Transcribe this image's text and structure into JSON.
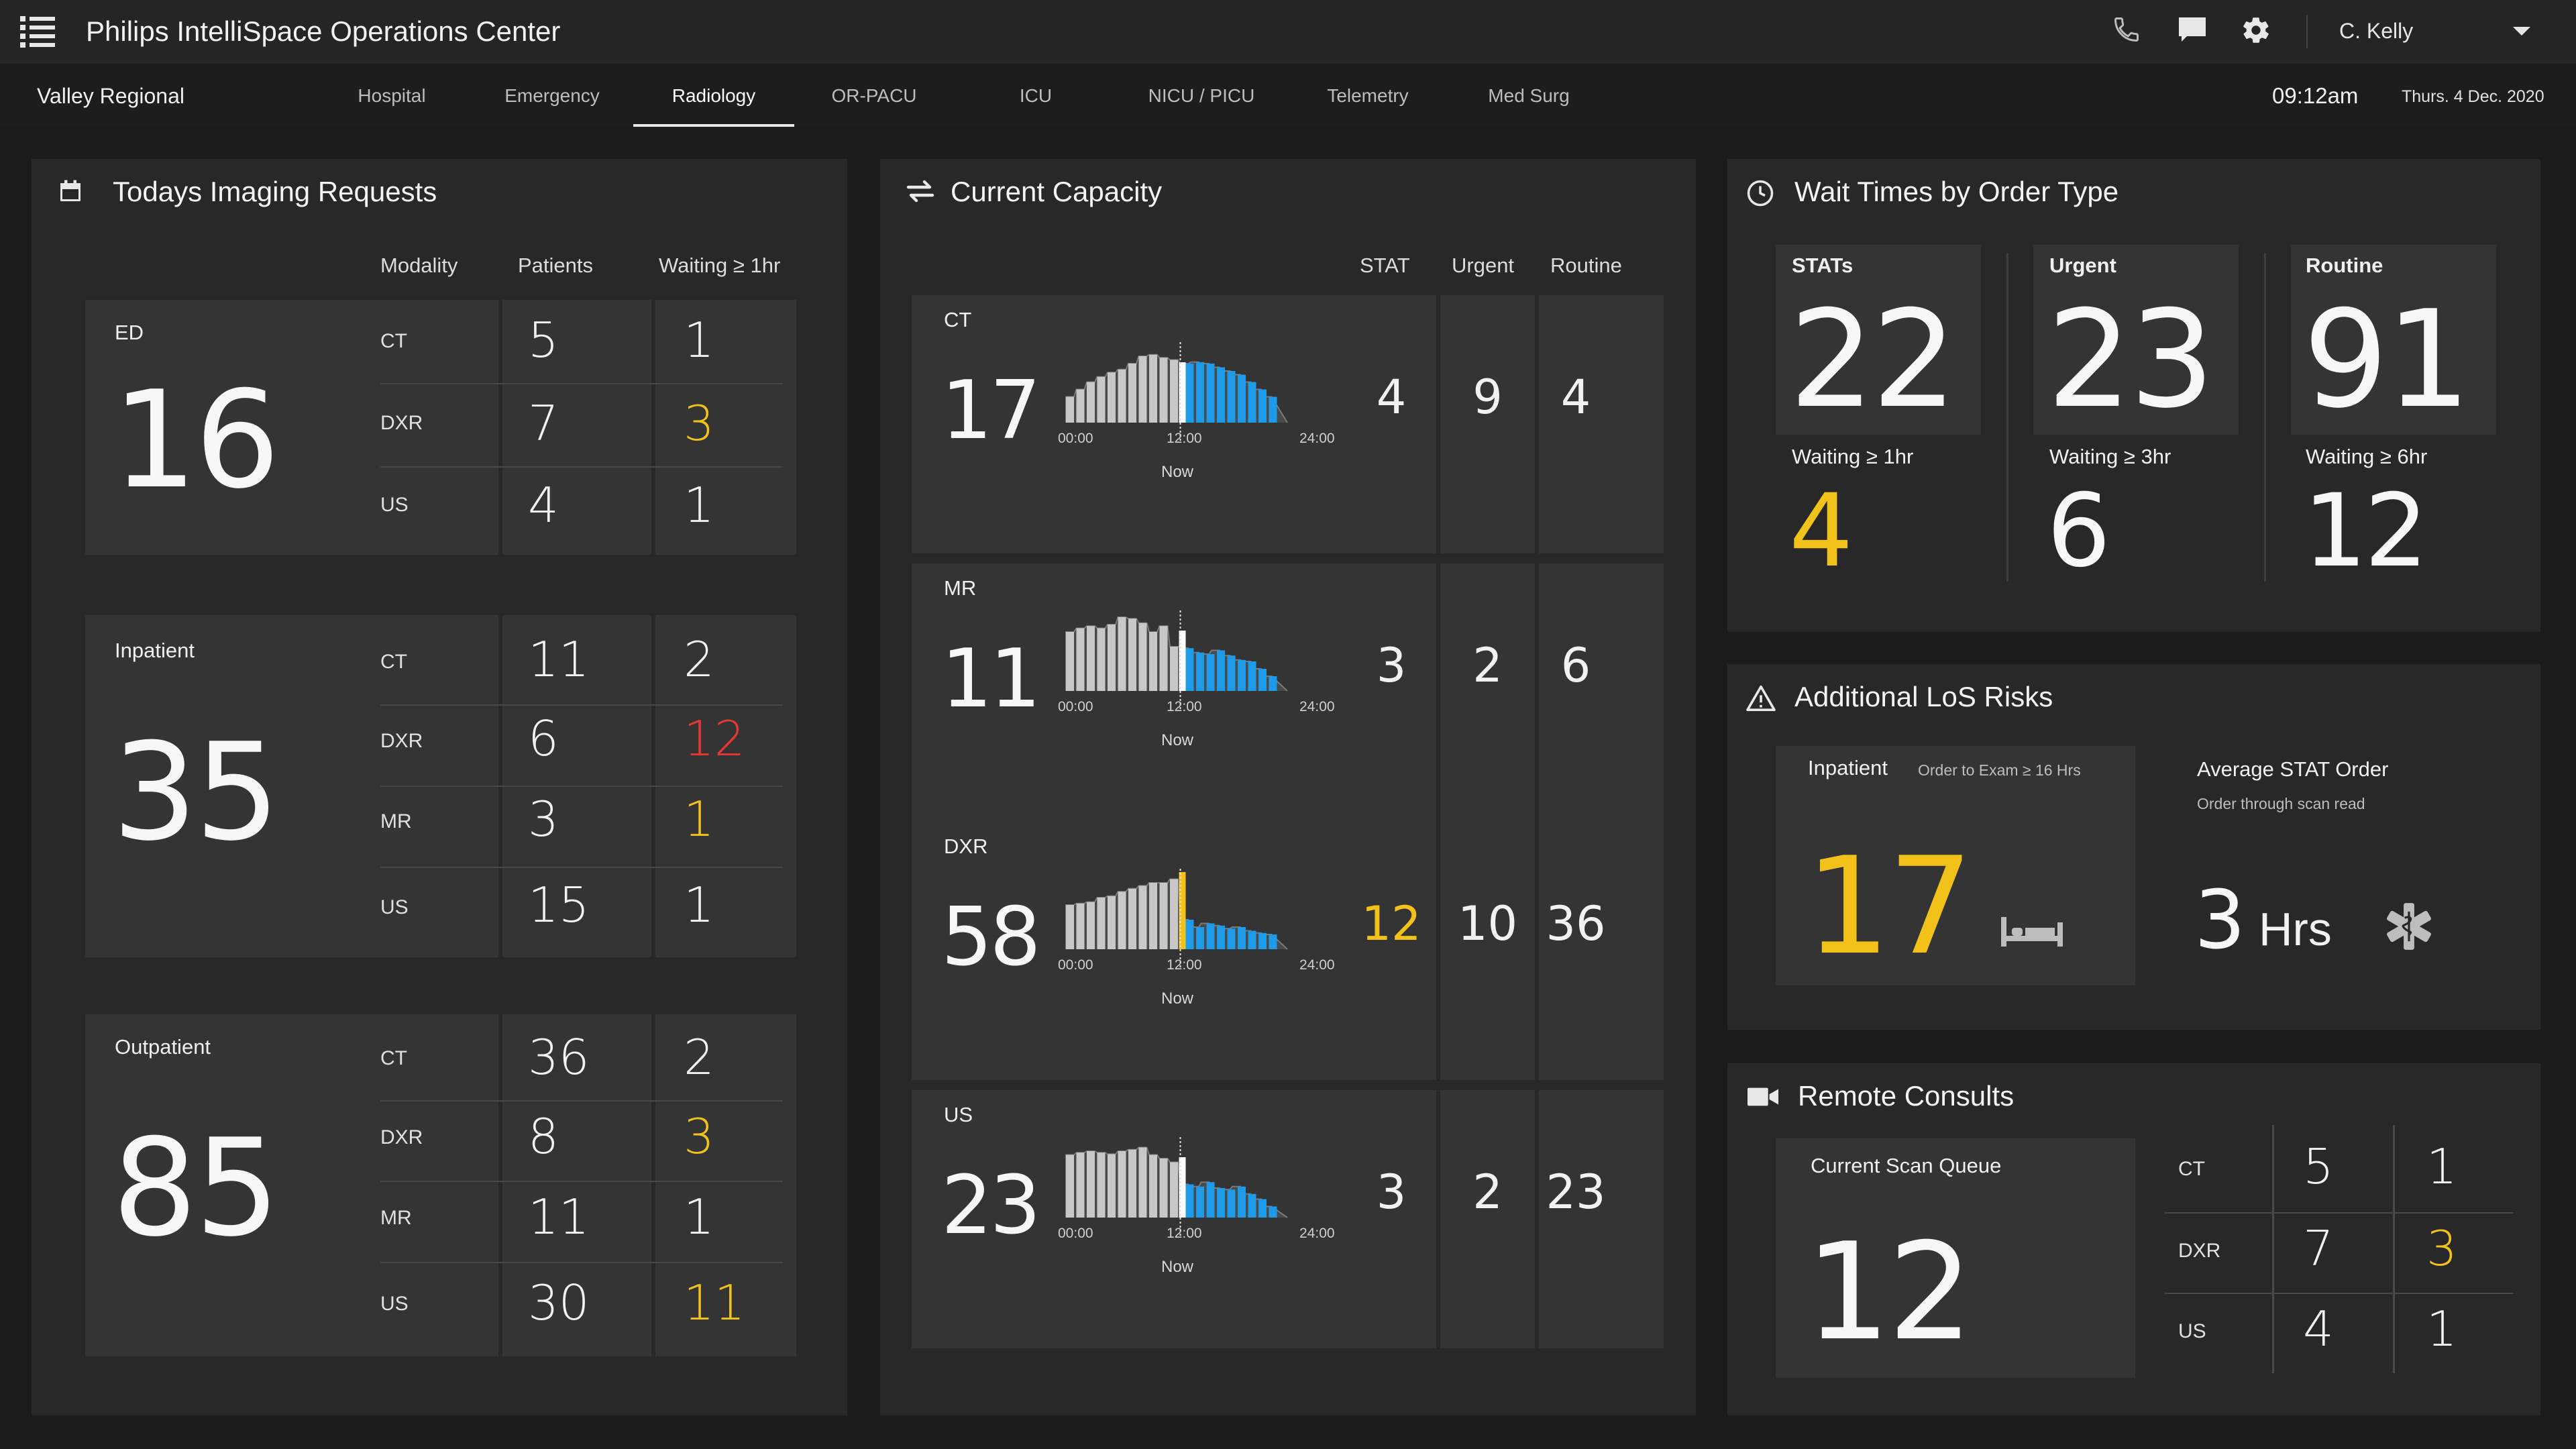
{
  "app": {
    "title": "Philips IntelliSpace Operations Center",
    "user": "C. Kelly",
    "icons": [
      "menu-icon",
      "phone-icon",
      "chat-icon",
      "gear-icon",
      "chevron-down-icon"
    ]
  },
  "nav": {
    "site": "Valley Regional",
    "tabs": [
      "Hospital",
      "Emergency",
      "Radiology",
      "OR-PACU",
      "ICU",
      "NICU / PICU",
      "Telemetry",
      "Med Surg"
    ],
    "active_tab": "Radiology",
    "time": "09:12am",
    "date": "Thurs. 4 Dec. 2020"
  },
  "colors": {
    "yellow": "#f2c21b",
    "red": "#e53935",
    "blue": "#1e9be8",
    "gray_bar": "#c8c8c8",
    "dark_bar": "#555555"
  },
  "imaging_requests": {
    "title": "Todays Imaging Requests",
    "headers": {
      "modality": "Modality",
      "patients": "Patients",
      "waiting": "Waiting ≥ 1hr"
    },
    "groups": [
      {
        "name": "ED",
        "total": "16",
        "rows": [
          {
            "modality": "CT",
            "patients": "5",
            "waiting": "1",
            "waiting_color": "normal"
          },
          {
            "modality": "DXR",
            "patients": "7",
            "waiting": "3",
            "waiting_color": "yellow"
          },
          {
            "modality": "US",
            "patients": "4",
            "waiting": "1",
            "waiting_color": "normal"
          }
        ]
      },
      {
        "name": "Inpatient",
        "total": "35",
        "rows": [
          {
            "modality": "CT",
            "patients": "11",
            "waiting": "2",
            "waiting_color": "normal"
          },
          {
            "modality": "DXR",
            "patients": "6",
            "waiting": "12",
            "waiting_color": "red"
          },
          {
            "modality": "MR",
            "patients": "3",
            "waiting": "1",
            "waiting_color": "yellow"
          },
          {
            "modality": "US",
            "patients": "15",
            "waiting": "1",
            "waiting_color": "normal"
          }
        ]
      },
      {
        "name": "Outpatient",
        "total": "85",
        "rows": [
          {
            "modality": "CT",
            "patients": "36",
            "waiting": "2",
            "waiting_color": "normal"
          },
          {
            "modality": "DXR",
            "patients": "8",
            "waiting": "3",
            "waiting_color": "yellow"
          },
          {
            "modality": "MR",
            "patients": "11",
            "waiting": "1",
            "waiting_color": "normal"
          },
          {
            "modality": "US",
            "patients": "30",
            "waiting": "11",
            "waiting_color": "yellow"
          }
        ]
      }
    ]
  },
  "capacity": {
    "title": "Current Capacity",
    "headers": {
      "stat": "STAT",
      "urgent": "Urgent",
      "routine": "Routine"
    },
    "axis": {
      "start": "00:00",
      "mid": "12:00",
      "end": "24:00",
      "now": "Now"
    },
    "rows": [
      {
        "modality": "CT",
        "total": "17",
        "stat": "4",
        "urgent": "9",
        "routine": "4",
        "stat_color": "normal",
        "now_marker": "white",
        "past": [
          0.35,
          0.45,
          0.55,
          0.62,
          0.68,
          0.72,
          0.8,
          0.9,
          0.92,
          0.88,
          0.85
        ],
        "future": [
          0.8,
          0.82,
          0.8,
          0.75,
          0.7,
          0.65,
          0.55,
          0.45,
          0.35
        ]
      },
      {
        "modality": "MR",
        "total": "11",
        "stat": "3",
        "urgent": "2",
        "routine": "6",
        "stat_color": "normal",
        "now_marker": "white",
        "past": [
          0.8,
          0.85,
          0.88,
          0.85,
          0.9,
          1.0,
          0.98,
          0.92,
          0.8,
          0.88,
          0.6
        ],
        "future": [
          0.58,
          0.52,
          0.5,
          0.55,
          0.48,
          0.42,
          0.4,
          0.3,
          0.2
        ]
      },
      {
        "modality": "DXR",
        "total": "58",
        "stat": "12",
        "urgent": "10",
        "routine": "36",
        "stat_color": "yellow",
        "now_marker": "yellow",
        "past": [
          0.6,
          0.62,
          0.64,
          0.7,
          0.72,
          0.78,
          0.82,
          0.86,
          0.9,
          0.9,
          0.95
        ],
        "future": [
          0.4,
          0.3,
          0.35,
          0.32,
          0.28,
          0.3,
          0.25,
          0.22,
          0.2
        ]
      },
      {
        "modality": "US",
        "total": "23",
        "stat": "3",
        "urgent": "2",
        "routine": "23",
        "stat_color": "normal",
        "now_marker": "white",
        "past": [
          0.85,
          0.88,
          0.9,
          0.88,
          0.86,
          0.9,
          0.92,
          0.95,
          0.85,
          0.8,
          0.75
        ],
        "future": [
          0.45,
          0.42,
          0.48,
          0.4,
          0.38,
          0.42,
          0.32,
          0.25,
          0.15
        ]
      }
    ]
  },
  "wait_times": {
    "title": "Wait Times by Order Type",
    "cards": [
      {
        "label": "STATs",
        "value": "22",
        "waiting_label": "Waiting ≥ 1hr",
        "waiting_value": "4",
        "waiting_color": "yellow"
      },
      {
        "label": "Urgent",
        "value": "23",
        "waiting_label": "Waiting ≥ 3hr",
        "waiting_value": "6",
        "waiting_color": "normal"
      },
      {
        "label": "Routine",
        "value": "91",
        "waiting_label": "Waiting ≥ 6hr",
        "waiting_value": "12",
        "waiting_color": "normal"
      }
    ]
  },
  "los_risks": {
    "title": "Additional LoS Risks",
    "inpatient_label": "Inpatient",
    "inpatient_sub": "Order to Exam ≥ 16 Hrs",
    "inpatient_value": "17",
    "avg_label": "Average STAT Order",
    "avg_sub": "Order through scan read",
    "avg_value": "3",
    "avg_unit": "Hrs"
  },
  "remote_consults": {
    "title": "Remote Consults",
    "queue_label": "Current Scan Queue",
    "queue_value": "12",
    "rows": [
      {
        "modality": "CT",
        "a": "5",
        "b": "1",
        "b_color": "normal"
      },
      {
        "modality": "DXR",
        "a": "7",
        "b": "3",
        "b_color": "yellow"
      },
      {
        "modality": "US",
        "a": "4",
        "b": "1",
        "b_color": "normal"
      }
    ]
  }
}
